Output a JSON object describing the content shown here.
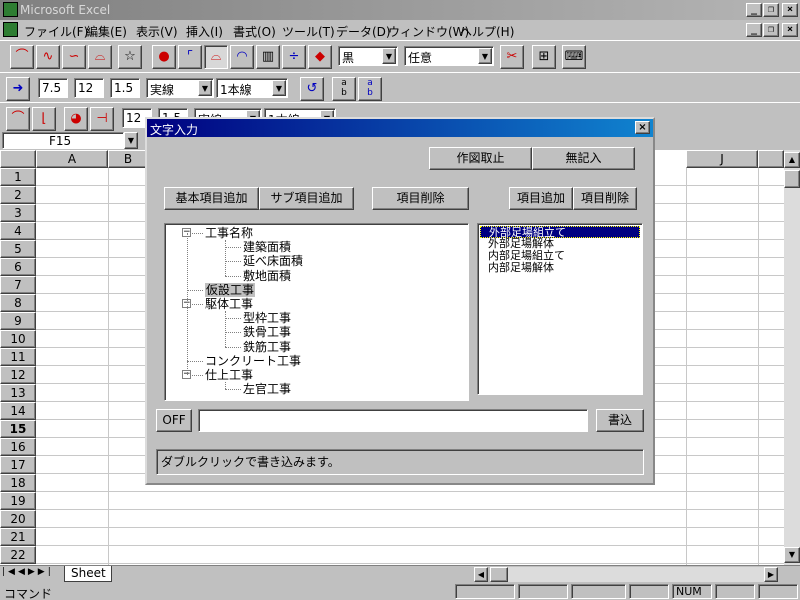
{
  "window": {
    "title": "Microsoft Excel"
  },
  "menu": [
    "ファイル(F)",
    "編集(E)",
    "表示(V)",
    "挿入(I)",
    "書式(O)",
    "ツール(T)",
    "データ(D)",
    "ウィンドウ(W)",
    "ヘルプ(H)"
  ],
  "toolbar1": {
    "color_value": "黒",
    "fill_value": "任意"
  },
  "toolbar2": {
    "width_value": "7.5",
    "size_value": "12",
    "scale_value": "1.5",
    "line_style": "実線",
    "line_count": "1本線",
    "text_a": "a\nb",
    "text_b": "a\nb"
  },
  "toolbar3": {
    "size_value": "12",
    "scale_value": "1.5",
    "line_style": "実線",
    "line_count": "1本線"
  },
  "name_box": "F15",
  "columns": [
    "A",
    "B",
    "J"
  ],
  "rows": [
    "1",
    "2",
    "3",
    "4",
    "5",
    "6",
    "7",
    "8",
    "9",
    "10",
    "11",
    "12",
    "13",
    "14",
    "15",
    "16",
    "17",
    "18",
    "19",
    "20",
    "21",
    "22"
  ],
  "sheet_tab": "Sheet",
  "status": {
    "command": "コマンド",
    "num": "NUM"
  },
  "dialog": {
    "title": "文字入力",
    "btn_cancel_drawing": "作図取止",
    "btn_no_entry": "無記入",
    "btn_add_basic": "基本項目追加",
    "btn_add_sub": "サブ項目追加",
    "btn_delete_item": "項目削除",
    "btn_add_item_right": "項目追加",
    "btn_delete_item_right": "項目削除",
    "tree": [
      {
        "label": "工事名称",
        "level": 0,
        "expander": "−"
      },
      {
        "label": "建築面積",
        "level": 1
      },
      {
        "label": "延べ床面積",
        "level": 1
      },
      {
        "label": "敷地面積",
        "level": 1
      },
      {
        "label": "仮設工事",
        "level": 0,
        "selected": true
      },
      {
        "label": "駆体工事",
        "level": 0,
        "expander": "−"
      },
      {
        "label": "型枠工事",
        "level": 1
      },
      {
        "label": "鉄骨工事",
        "level": 1
      },
      {
        "label": "鉄筋工事",
        "level": 1
      },
      {
        "label": "コンクリート工事",
        "level": 0
      },
      {
        "label": "仕上工事",
        "level": 0,
        "expander": "−"
      },
      {
        "label": "左官工事",
        "level": 1
      }
    ],
    "list": [
      "外部足場組立て",
      "外部足場解体",
      "内部足場組立て",
      "内部足場解体"
    ],
    "off_label": "OFF",
    "input_value": "",
    "btn_write": "書込",
    "hint": "ダブルクリックで書き込みます。"
  },
  "colors": {
    "titlebar_active": "#000080",
    "titlebar_active_end": "#1084d0",
    "selection": "#000080",
    "face": "#c0c0c0"
  }
}
